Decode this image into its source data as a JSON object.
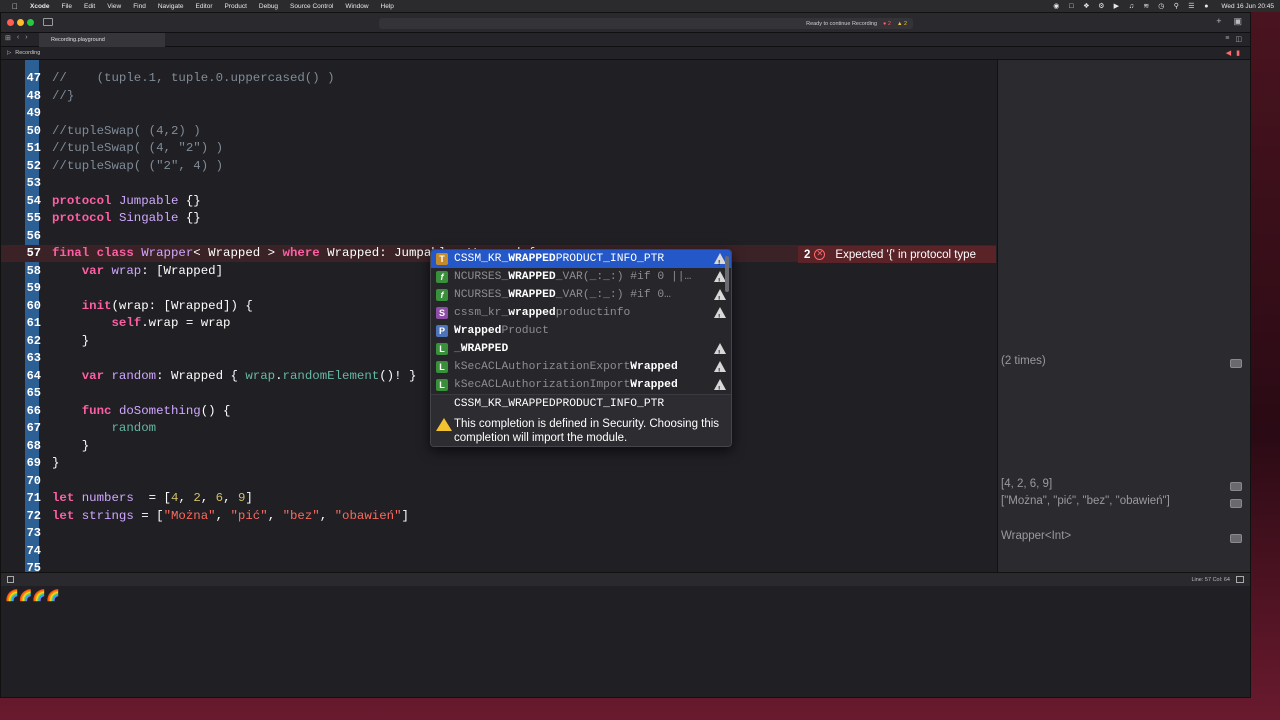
{
  "menubar": {
    "app": "Xcode",
    "items": [
      "File",
      "Edit",
      "View",
      "Find",
      "Navigate",
      "Editor",
      "Product",
      "Debug",
      "Source Control",
      "Window",
      "Help"
    ],
    "clock": "Wed 16 Jun  20:45"
  },
  "toolbar": {
    "activity_status": "Ready to continue Recording",
    "error_count": "2",
    "warning_count": "2"
  },
  "tab": {
    "label": "Recording.playground"
  },
  "jumpbar": {
    "item": "Recording"
  },
  "editor": {
    "lines": [
      {
        "n": "47",
        "segs": [
          [
            "cm",
            "//    (tuple.1, tuple.0.uppercased() )"
          ]
        ]
      },
      {
        "n": "48",
        "segs": [
          [
            "cm",
            "//}"
          ]
        ]
      },
      {
        "n": "49",
        "segs": []
      },
      {
        "n": "50",
        "segs": [
          [
            "cm",
            "//tupleSwap( (4,2) )"
          ]
        ]
      },
      {
        "n": "51",
        "segs": [
          [
            "cm",
            "//tupleSwap( (4, \"2\") )"
          ]
        ]
      },
      {
        "n": "52",
        "segs": [
          [
            "cm",
            "//tupleSwap( (\"2\", 4) )"
          ]
        ]
      },
      {
        "n": "53",
        "segs": []
      },
      {
        "n": "54",
        "segs": [
          [
            "kw",
            "protocol"
          ],
          [
            "pl",
            " "
          ],
          [
            "ty",
            "Jumpable"
          ],
          [
            "pl",
            " {}"
          ]
        ]
      },
      {
        "n": "55",
        "segs": [
          [
            "kw",
            "protocol"
          ],
          [
            "pl",
            " "
          ],
          [
            "ty",
            "Singable"
          ],
          [
            "pl",
            " {}"
          ]
        ]
      },
      {
        "n": "56",
        "segs": []
      },
      {
        "n": "57",
        "error": true,
        "segs": [
          [
            "kw",
            "final class"
          ],
          [
            "pl",
            " "
          ],
          [
            "ty",
            "Wrapper"
          ],
          [
            "pl",
            "< Wrapped > "
          ],
          [
            "kw",
            "where"
          ],
          [
            "pl",
            " Wrapped: Jumpable, Wrapped {"
          ]
        ]
      },
      {
        "n": "58",
        "segs": [
          [
            "pl",
            "    "
          ],
          [
            "kw",
            "var"
          ],
          [
            "pl",
            " "
          ],
          [
            "ty",
            "wrap"
          ],
          [
            "pl",
            ": [Wrapped]"
          ]
        ]
      },
      {
        "n": "59",
        "segs": []
      },
      {
        "n": "60",
        "segs": [
          [
            "pl",
            "    "
          ],
          [
            "kw",
            "init"
          ],
          [
            "pl",
            "(wrap: [Wrapped]) {"
          ]
        ]
      },
      {
        "n": "61",
        "segs": [
          [
            "pl",
            "        "
          ],
          [
            "kw",
            "self"
          ],
          [
            "pl",
            ".wrap = wrap"
          ]
        ]
      },
      {
        "n": "62",
        "segs": [
          [
            "pl",
            "    }"
          ]
        ]
      },
      {
        "n": "63",
        "segs": []
      },
      {
        "n": "64",
        "segs": [
          [
            "pl",
            "    "
          ],
          [
            "kw",
            "var"
          ],
          [
            "pl",
            " "
          ],
          [
            "ty",
            "random"
          ],
          [
            "pl",
            ": Wrapped { "
          ],
          [
            "fn",
            "wrap"
          ],
          [
            "pl",
            "."
          ],
          [
            "fn",
            "randomElement"
          ],
          [
            "pl",
            "()! }"
          ]
        ]
      },
      {
        "n": "65",
        "segs": []
      },
      {
        "n": "66",
        "segs": [
          [
            "pl",
            "    "
          ],
          [
            "kw",
            "func"
          ],
          [
            "pl",
            " "
          ],
          [
            "ty",
            "doSomething"
          ],
          [
            "pl",
            "() {"
          ]
        ]
      },
      {
        "n": "67",
        "segs": [
          [
            "pl",
            "        "
          ],
          [
            "fn",
            "random"
          ]
        ]
      },
      {
        "n": "68",
        "segs": [
          [
            "pl",
            "    }"
          ]
        ]
      },
      {
        "n": "69",
        "segs": [
          [
            "pl",
            "}"
          ]
        ]
      },
      {
        "n": "70",
        "segs": []
      },
      {
        "n": "71",
        "segs": [
          [
            "kw",
            "let"
          ],
          [
            "pl",
            " "
          ],
          [
            "ty",
            "numbers"
          ],
          [
            "pl",
            "  = ["
          ],
          [
            "num",
            "4"
          ],
          [
            "pl",
            ", "
          ],
          [
            "num",
            "2"
          ],
          [
            "pl",
            ", "
          ],
          [
            "num",
            "6"
          ],
          [
            "pl",
            ", "
          ],
          [
            "num",
            "9"
          ],
          [
            "pl",
            "]"
          ]
        ]
      },
      {
        "n": "72",
        "segs": [
          [
            "kw",
            "let"
          ],
          [
            "pl",
            " "
          ],
          [
            "ty",
            "strings"
          ],
          [
            "pl",
            " = ["
          ],
          [
            "str",
            "\"Można\""
          ],
          [
            "pl",
            ", "
          ],
          [
            "str",
            "\"pić\""
          ],
          [
            "pl",
            ", "
          ],
          [
            "str",
            "\"bez\""
          ],
          [
            "pl",
            ", "
          ],
          [
            "str",
            "\"obawień\""
          ],
          [
            "pl",
            "]"
          ]
        ]
      },
      {
        "n": "73",
        "segs": []
      },
      {
        "n": "74",
        "segs": []
      },
      {
        "n": "75",
        "segs": []
      },
      {
        "n": "76",
        "segs": []
      }
    ]
  },
  "error": {
    "count": "2",
    "message": "Expected '{' in protocol type"
  },
  "results": [
    {
      "text": "(2 times)",
      "line": "64"
    },
    {
      "text": "[4, 2, 6, 9]",
      "line": "71"
    },
    {
      "text": "[\"Można\", \"pić\", \"bez\", \"obawień\"]",
      "line": "72"
    },
    {
      "text": "Wrapper<Int>",
      "line": "74"
    }
  ],
  "completion": {
    "items": [
      {
        "badge": "T",
        "pre": "CSSM_KR_",
        "bold": "WRAPPED",
        "post": "PRODUCT_INFO_PTR",
        "deprecated": true,
        "selected": true
      },
      {
        "badge": "f",
        "pre": "NCURSES_",
        "bold": "WRAPPED",
        "post": "_VAR(_:_:) #if 0 ||…",
        "deprecated": true
      },
      {
        "badge": "f",
        "pre": "NCURSES_",
        "bold": "WRAPPED",
        "post": "_VAR(_:_:) #if 0…",
        "deprecated": true
      },
      {
        "badge": "S",
        "pre": "cssm_kr_",
        "bold": "wrapped",
        "post": "productinfo",
        "deprecated": true
      },
      {
        "badge": "P",
        "pre": "",
        "bold": "Wrapped",
        "post": "Product",
        "deprecated": false
      },
      {
        "badge": "L",
        "pre": "_",
        "bold": "WRAPPED",
        "post": "",
        "deprecated": true
      },
      {
        "badge": "L",
        "pre": "kSecACLAuthorizationExport",
        "bold": "Wrapped",
        "post": "",
        "deprecated": true
      },
      {
        "badge": "L",
        "pre": "kSecACLAuthorizationImport",
        "bold": "Wrapped",
        "post": "",
        "deprecated": true
      }
    ],
    "detail_signature": "CSSM_KR_WRAPPEDPRODUCT_INFO_PTR",
    "detail_note": "This completion is defined in Security. Choosing this completion will import the module."
  },
  "debug": {
    "position": "Line: 57  Col: 64",
    "console_output": "🌈🌈🌈🌈"
  }
}
